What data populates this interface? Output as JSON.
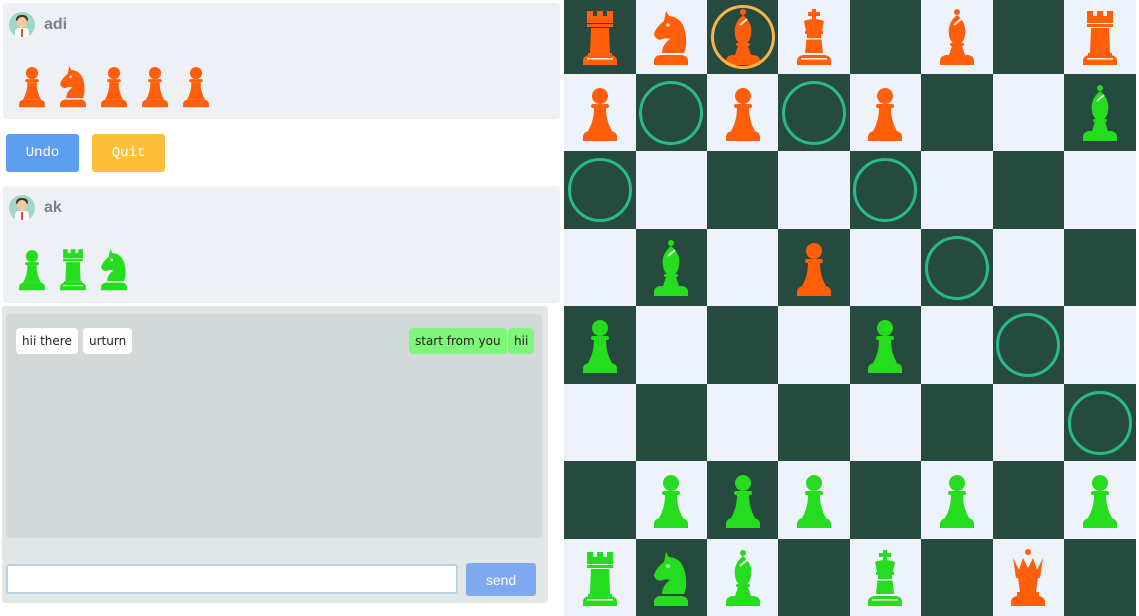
{
  "colors": {
    "light_square": "#eef3fb",
    "dark_square": "#264a3e",
    "orange_piece": "#ff5e0a",
    "green_piece": "#26dc1f",
    "hint_ring": "#2ab98c",
    "selected_ring": "#f6b548"
  },
  "players": {
    "top": {
      "name": "adi",
      "avatar": "person-avatar-icon",
      "captured": [
        {
          "piece": "pawn",
          "color": "orange"
        },
        {
          "piece": "knight",
          "color": "orange"
        },
        {
          "piece": "pawn",
          "color": "orange"
        },
        {
          "piece": "pawn",
          "color": "orange"
        },
        {
          "piece": "pawn",
          "color": "orange"
        }
      ]
    },
    "bottom": {
      "name": "ak",
      "avatar": "person-avatar-icon",
      "captured": [
        {
          "piece": "pawn",
          "color": "green"
        },
        {
          "piece": "rook",
          "color": "green"
        },
        {
          "piece": "knight",
          "color": "green"
        }
      ]
    }
  },
  "controls": {
    "undo_label": "Undo",
    "quit_label": "Quit"
  },
  "chat": {
    "received": [
      "hii there",
      "urturn"
    ],
    "sent": [
      "start from you",
      "hii"
    ],
    "input_value": "",
    "send_label": "send"
  },
  "board": {
    "rows": [
      [
        "oR",
        "oN",
        "oB",
        "oK",
        "",
        "oB",
        "",
        "oR"
      ],
      [
        "oP",
        "",
        "oP",
        "",
        "oP",
        "",
        "",
        "gB"
      ],
      [
        "",
        "",
        "",
        "",
        "",
        "",
        "",
        ""
      ],
      [
        "",
        "gB",
        "",
        "oP",
        "",
        "",
        "",
        ""
      ],
      [
        "gP",
        "",
        "",
        "",
        "gP",
        "",
        "",
        ""
      ],
      [
        "",
        "",
        "",
        "",
        "",
        "",
        "",
        ""
      ],
      [
        "",
        "gP",
        "gP",
        "gP",
        "",
        "gP",
        "",
        "gP"
      ],
      [
        "gR",
        "gN",
        "gB",
        "",
        "gK",
        "",
        "oQ",
        ""
      ]
    ],
    "selected": {
      "row": 0,
      "col": 2
    },
    "move_hints": [
      {
        "row": 1,
        "col": 1
      },
      {
        "row": 1,
        "col": 3
      },
      {
        "row": 2,
        "col": 0
      },
      {
        "row": 2,
        "col": 4
      },
      {
        "row": 3,
        "col": 5
      },
      {
        "row": 4,
        "col": 6
      },
      {
        "row": 5,
        "col": 7
      }
    ]
  }
}
